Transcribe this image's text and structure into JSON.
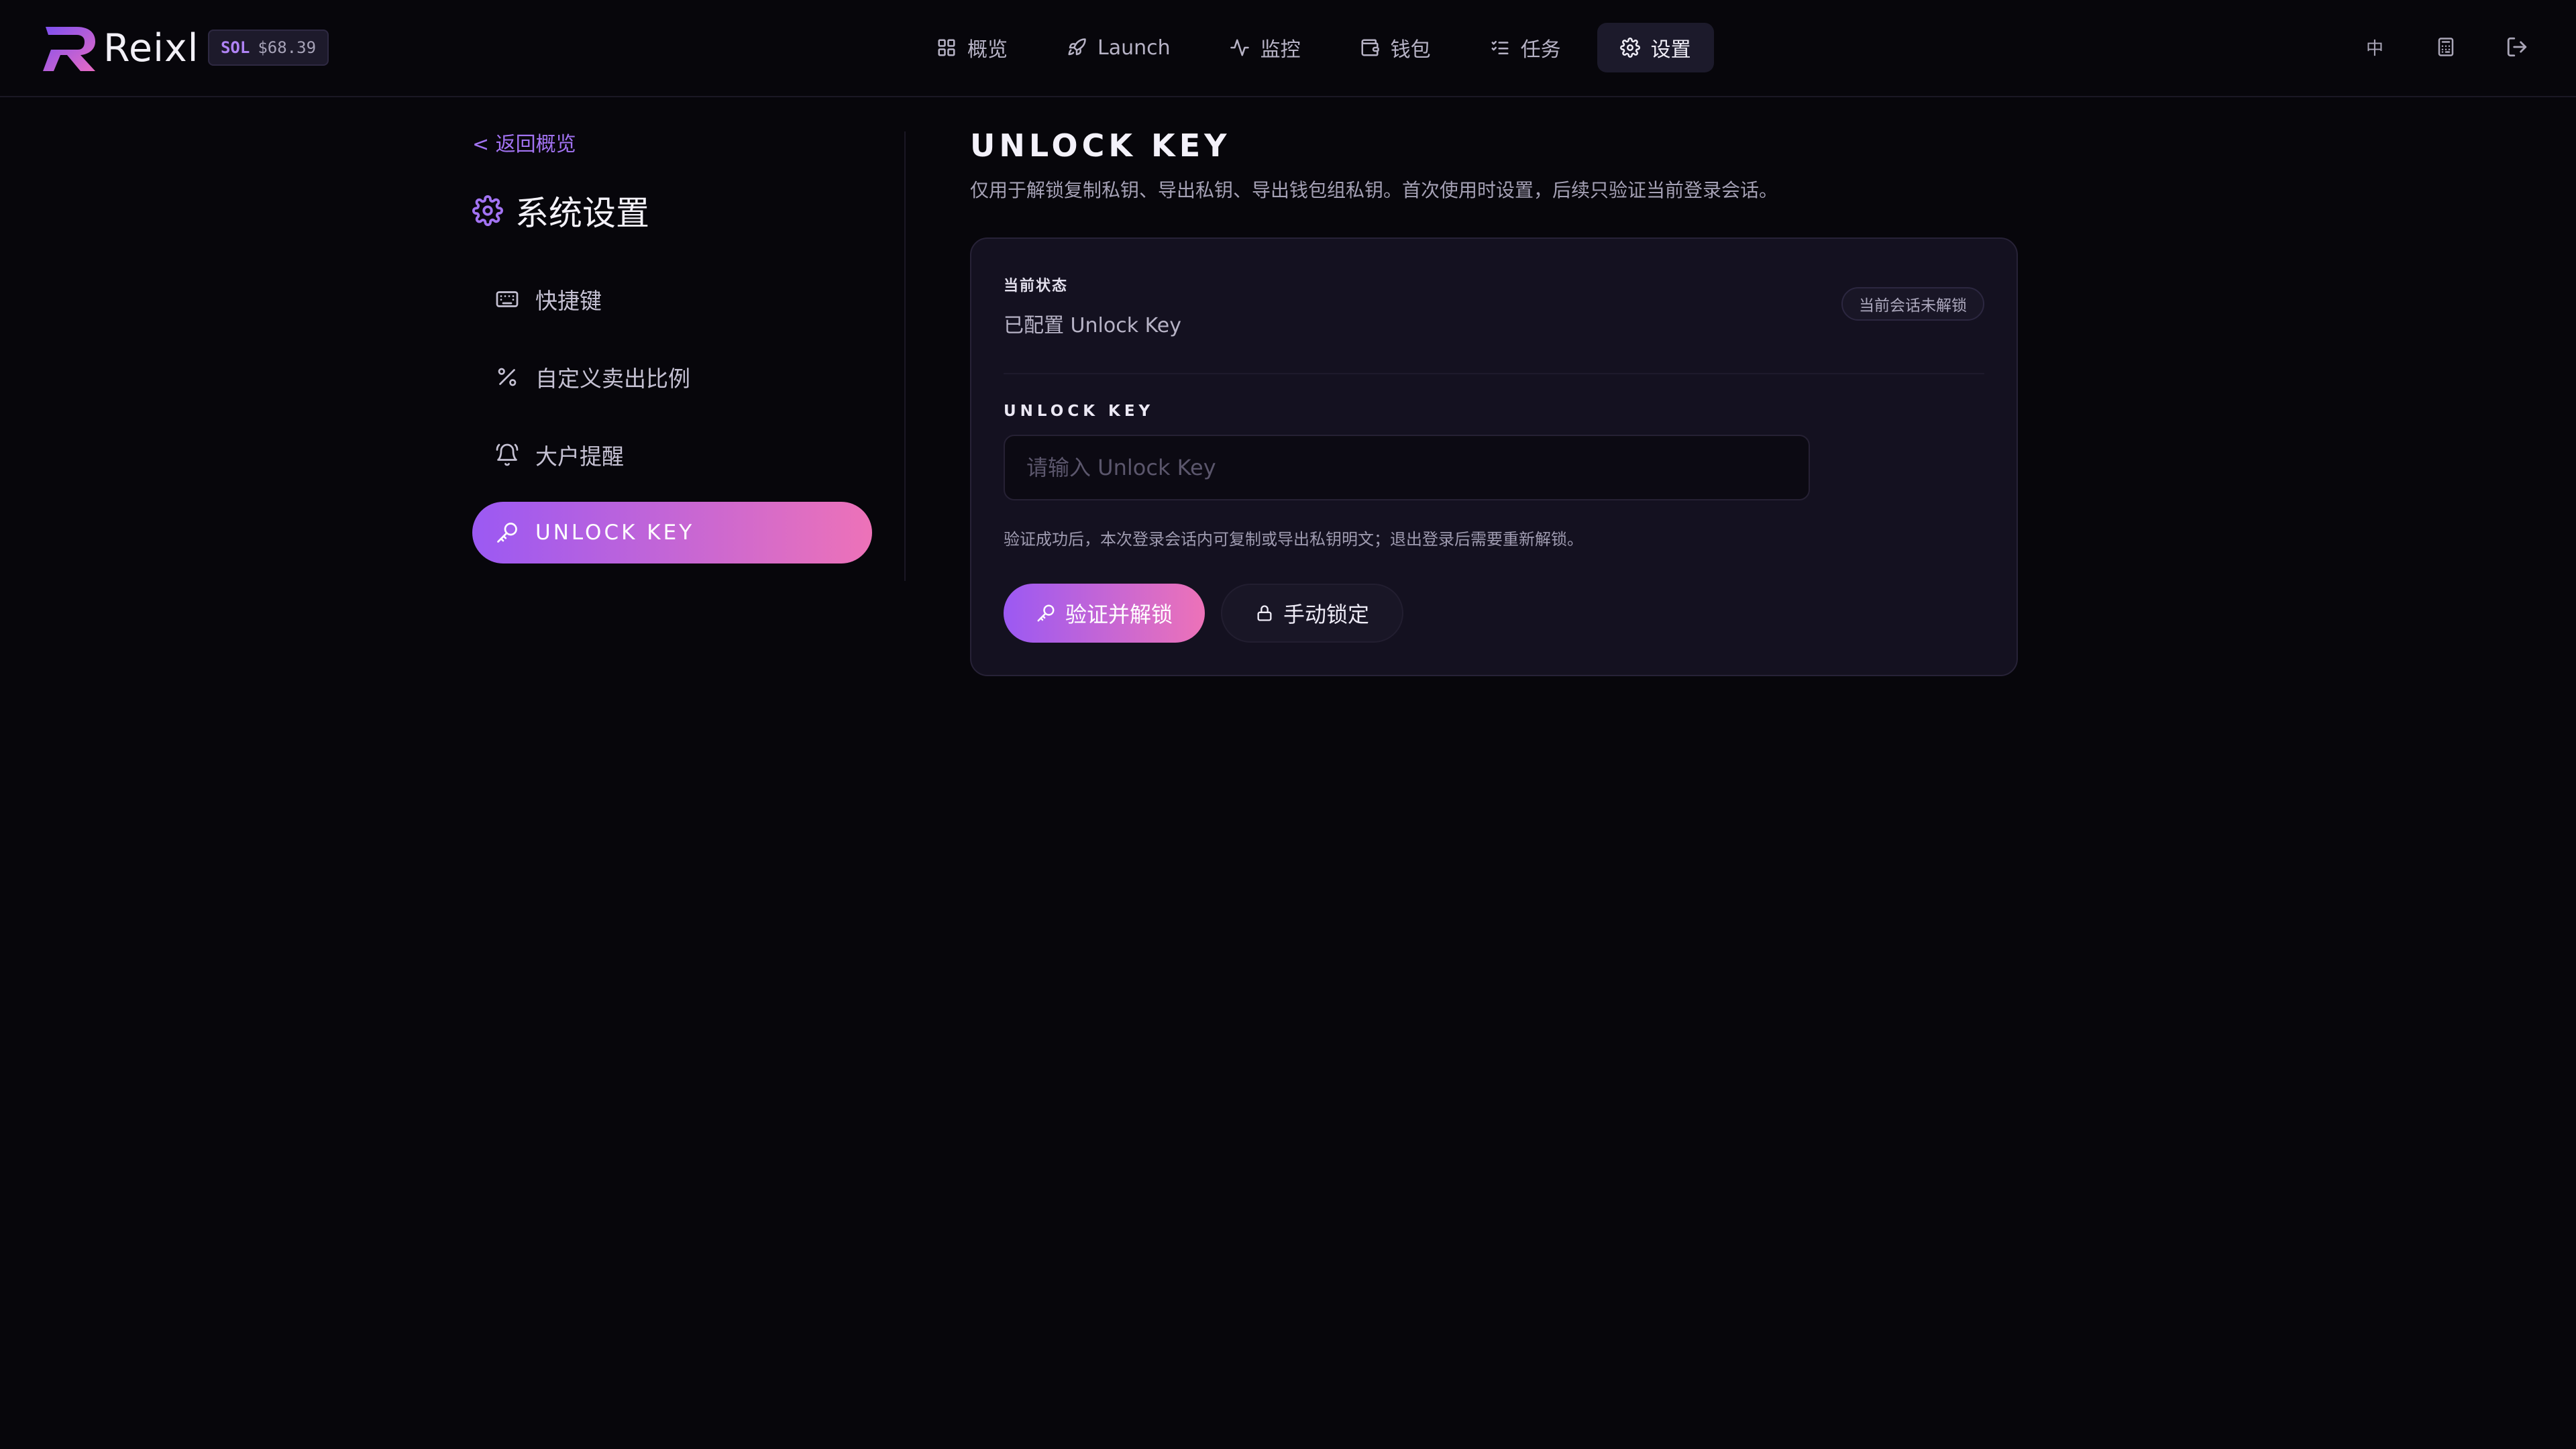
{
  "header": {
    "brand": "Reixl",
    "sol_chip": {
      "symbol": "SOL",
      "price": "$68.39"
    },
    "nav": [
      {
        "label": "概览",
        "icon": "grid-icon"
      },
      {
        "label": "Launch",
        "icon": "rocket-icon"
      },
      {
        "label": "监控",
        "icon": "activity-icon"
      },
      {
        "label": "钱包",
        "icon": "wallet-icon"
      },
      {
        "label": "任务",
        "icon": "list-checks-icon"
      },
      {
        "label": "设置",
        "icon": "gear-icon",
        "active": true
      }
    ],
    "language": "中",
    "actions": [
      "calculator-icon",
      "logout-icon"
    ]
  },
  "sidebar": {
    "back_label": "< 返回概览",
    "title": "系统设置",
    "items": [
      {
        "label": "快捷键",
        "icon": "keyboard-icon"
      },
      {
        "label": "自定义卖出比例",
        "icon": "percent-icon"
      },
      {
        "label": "大户提醒",
        "icon": "bell-icon"
      },
      {
        "label": "UNLOCK KEY",
        "icon": "key-icon",
        "active": true
      }
    ]
  },
  "main": {
    "title": "UNLOCK KEY",
    "description": "仅用于解锁复制私钥、导出私钥、导出钱包组私钥。首次使用时设置，后续只验证当前登录会话。",
    "card": {
      "status_label": "当前状态",
      "status_value": "已配置 Unlock Key",
      "session_badge": "当前会话未解锁",
      "key_label": "UNLOCK KEY",
      "key_placeholder": "请输入 Unlock Key",
      "key_value": "",
      "hint": "验证成功后，本次登录会话内可复制或导出私钥明文；退出登录后需要重新解锁。",
      "unlock_button": "验证并解锁",
      "lock_button": "手动锁定"
    }
  },
  "colors": {
    "background": "#07060b",
    "accent_start": "#9b59f3",
    "accent_end": "#ed72b8",
    "link": "#a273f2"
  }
}
